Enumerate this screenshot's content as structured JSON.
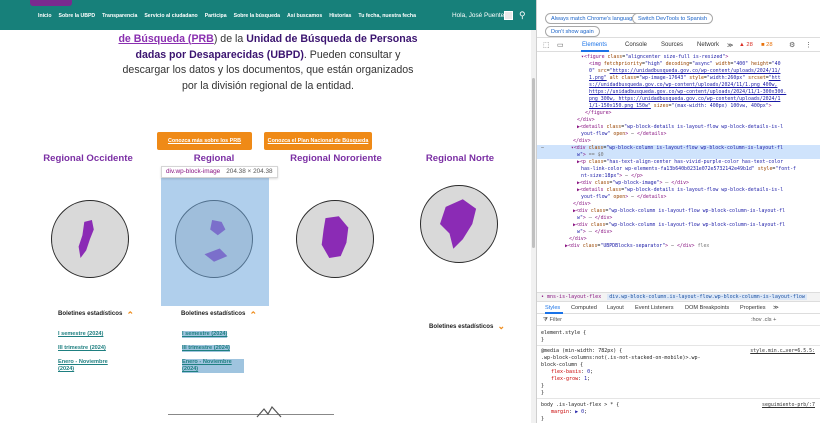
{
  "site": {
    "nav": {
      "links": [
        "Inicio",
        "Sobre la UBPD",
        "Transparencia",
        "Servicio al ciudadano",
        "Participa",
        "Sobre la búsqueda",
        "Así buscamos",
        "Historias",
        "Tu fecha, nuestra fecha"
      ],
      "greeting": "Hola, José Puentes"
    },
    "intro": {
      "l1a": "de Búsqueda (",
      "l1acr": "PRB",
      "l1b": ") de la ",
      "l1c": "Unidad de Búsqueda de Personas",
      "l2": "dadas por Desaparecidas (UBPD)",
      "l2b": ". Pueden consultar y",
      "l3": "descargar los datos y los documentos, que están organizados",
      "l4": "por la división regional de la entidad."
    },
    "buttons": {
      "prb": "Conozca más sobre los PRB",
      "plan": "Conozca el Plan Nacional de Búsqueda"
    },
    "regions": [
      {
        "title": "Regional Occidente",
        "boletin": "Boletines estadísticos",
        "links": [
          "I semestre (2024)",
          "III trimestre (2024)",
          "Enero - Noviembre (2024)"
        ]
      },
      {
        "title": "Regional",
        "boletin": "Boletines estadísticos",
        "links": [
          "I semestre (2024)",
          "III trimestre (2024)",
          "Enero - Noviembre (2024)"
        ]
      },
      {
        "title": "Regional Nororiente",
        "boletin": "",
        "links": []
      },
      {
        "title": "Regional Norte",
        "boletin": "Boletines estadísticos",
        "links": []
      }
    ],
    "tooltip": {
      "tag": "div.wp-block-image",
      "dims": "204.38 × 204.38"
    }
  },
  "devtools": {
    "banner": {
      "match": "Always match Chrome's language",
      "switch": "Switch DevTools to Spanish",
      "dont": "Don't show again"
    },
    "tabs": [
      "Elements",
      "Console",
      "Sources",
      "Network",
      "≫"
    ],
    "errors": "28",
    "warnings": "28",
    "breadcrumb": {
      "a": "• mns-is-layout-flex",
      "b": "div.wp-block-column.is-layout-flow.wp-block-column-is-layout-flow"
    },
    "style_tabs": [
      "Styles",
      "Computed",
      "Layout",
      "Event Listeners",
      "DOM Breakpoints",
      "Properties",
      "≫"
    ],
    "filter": {
      "placeholder": "Filter",
      "right": ":hov .cls +"
    },
    "styles": {
      "element_style": "element.style {",
      "media": "@media (min-width: 782px) {",
      "rule1": ".wp-block-columns:not(.is-not-stacked-on-mobile)>.wp-",
      "rule1b": "block-column {",
      "p1": "flex-basis",
      "v1": "0",
      "p2": "flex-grow",
      "v2": "1",
      "src1": "style.min.c…ver=6.5.5:",
      "rule2": "body .is-layout-flex > * {",
      "p3": "margin",
      "v3": "▶ 0",
      "src2": "seguimiento-prb/:7"
    }
  }
}
